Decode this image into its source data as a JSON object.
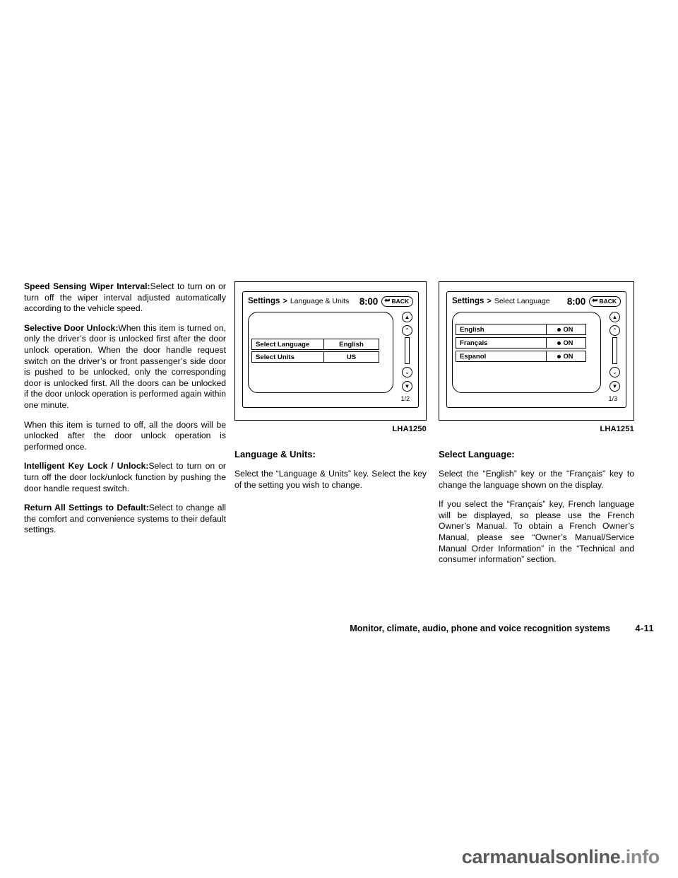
{
  "left_column": {
    "paragraphs": [
      {
        "lead": "Speed Sensing Wiper Interval:",
        "text": "Select to turn on or turn off the wiper interval adjusted automatically according to the vehicle speed."
      },
      {
        "lead": "Selective Door Unlock:",
        "text": "When this item is turned on, only the driver’s door is unlocked first after the door unlock operation. When the door handle request switch on the driver’s or front passenger’s side door is pushed to be unlocked, only the corresponding door is unlocked first. All the doors can be unlocked if the door unlock operation is performed again within one minute."
      },
      {
        "lead": "",
        "text": "When this item is turned to off, all the doors will be unlocked after the door unlock operation is performed once."
      },
      {
        "lead": "Intelligent Key Lock / Unlock:",
        "text": "Select to turn on or turn off the door lock/unlock function by pushing the door handle request switch."
      },
      {
        "lead": "Return All Settings to Default:",
        "text": "Select to change all the comfort and convenience systems to their default settings."
      }
    ]
  },
  "mid_column": {
    "figure": {
      "caption": "LHA1250",
      "screen": {
        "title": "Settings",
        "separator": ">",
        "breadcrumb": "Language & Units",
        "clock": "8:00",
        "back_label": "BACK",
        "back_icon": "back-arrow-icon",
        "page_indicator": "1/2",
        "rows": [
          {
            "label": "Select Language",
            "value": "English"
          },
          {
            "label": "Select Units",
            "value": "US"
          }
        ],
        "controls": [
          "scroll-up-fast-icon",
          "scroll-up-icon",
          "scroll-down-icon",
          "scroll-down-fast-icon"
        ]
      }
    },
    "heading": "Language & Units:",
    "paragraphs": [
      {
        "text": "Select the “Language & Units” key. Select the key of the setting you wish to change."
      }
    ]
  },
  "right_column": {
    "figure": {
      "caption": "LHA1251",
      "screen": {
        "title": "Settings",
        "separator": ">",
        "breadcrumb": "Select Language",
        "clock": "8:00",
        "back_label": "BACK",
        "back_icon": "back-arrow-icon",
        "page_indicator": "1/3",
        "rows": [
          {
            "label": "English",
            "value": "ON"
          },
          {
            "label": "Français",
            "value": "ON"
          },
          {
            "label": "Espanol",
            "value": "ON"
          }
        ],
        "controls": [
          "scroll-up-fast-icon",
          "scroll-up-icon",
          "scroll-down-icon",
          "scroll-down-fast-icon"
        ]
      }
    },
    "heading": "Select Language:",
    "paragraphs": [
      {
        "text": "Select the “English” key or the “Français” key to change the language shown on the display."
      },
      {
        "text": "If you select the “Français” key, French language will be displayed, so please use the French Owner’s Manual. To obtain a French Owner’s Manual, please see “Owner’s Manual/Service Manual Order Information” in the “Technical and consumer information” section."
      }
    ]
  },
  "footer": {
    "section_title": "Monitor, climate, audio, phone and voice recognition systems",
    "page_number": "4-11"
  },
  "watermark": {
    "name": "carmanualsonline",
    "tld": ".info"
  }
}
